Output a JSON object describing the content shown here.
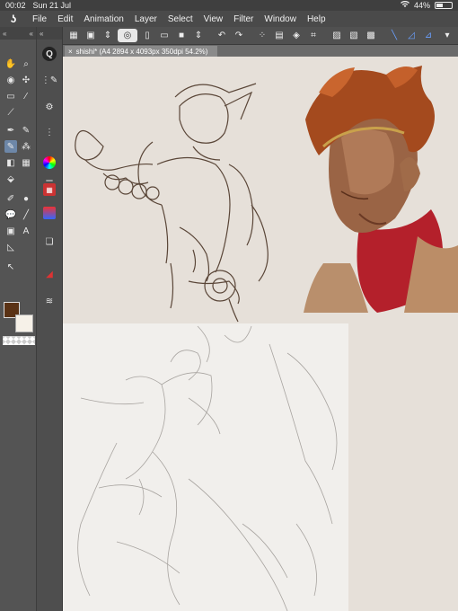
{
  "status": {
    "time": "00:02",
    "date": "Sun 21 Jul",
    "battery_text": "44%",
    "battery_level": 0.44
  },
  "menu": [
    "File",
    "Edit",
    "Animation",
    "Layer",
    "Select",
    "View",
    "Filter",
    "Window",
    "Help"
  ],
  "document": {
    "tab_label": "shishi* (A4 2894 x 4093px 350dpi 54.2%)"
  },
  "colors": {
    "main": "#5a3215",
    "sub": "#f6f1e8",
    "accent": "#6d87a8"
  },
  "tools_col1": [
    "hand-icon",
    "zoom-icon",
    "rotate-icon",
    "move-icon",
    "select-icon",
    "wand-icon",
    "eyedropper-icon",
    "pen-icon",
    "pencil-icon",
    "brush-icon",
    "airbrush-icon",
    "eraser-icon",
    "gradient-icon",
    "fill-icon",
    "blend-icon",
    "figure-icon",
    "balloon-icon",
    "line-icon",
    "frame-icon",
    "text-icon",
    "ruler-icon",
    "operation-icon"
  ],
  "tools_col2": [
    "quick-access-icon",
    "sub-tool-icon",
    "tool-property-icon",
    "brush-size-icon",
    "color-wheel-icon",
    "color-slider-icon",
    "color-set-icon",
    "intermediate-color-icon",
    "layer-icon",
    "layer-property-icon",
    "navigator-icon",
    "material-icon"
  ],
  "commands": [
    "panel-toggle-icon",
    "camera-icon",
    "arrows-icon",
    "spiral-icon",
    "new-file-icon",
    "open-icon",
    "save-icon",
    "undo-icon",
    "redo-icon",
    "transform-icon",
    "fill-selection-icon",
    "snap-icon",
    "ruler-toggle-icon",
    "perspective-icon",
    "symmetry-icon"
  ]
}
